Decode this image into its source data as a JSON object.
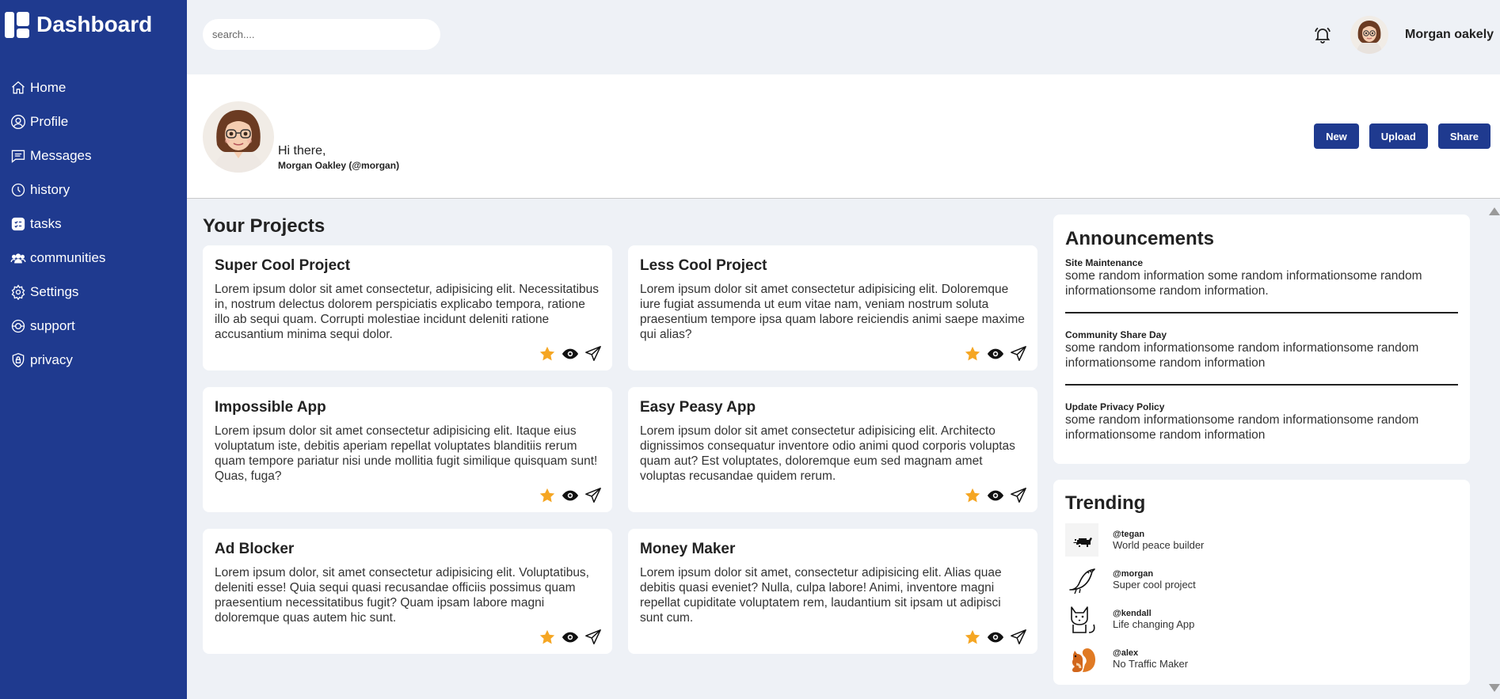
{
  "sidebar": {
    "brand": "Dashboard",
    "items": [
      {
        "label": "Home",
        "icon": "home-icon"
      },
      {
        "label": "Profile",
        "icon": "user-circle-icon"
      },
      {
        "label": "Messages",
        "icon": "message-icon"
      },
      {
        "label": "history",
        "icon": "history-icon"
      },
      {
        "label": "tasks",
        "icon": "tasks-icon"
      },
      {
        "label": "communities",
        "icon": "users-icon"
      },
      {
        "label": "Settings",
        "icon": "gear-icon"
      },
      {
        "label": "support",
        "icon": "support-icon"
      },
      {
        "label": "privacy",
        "icon": "shield-icon"
      }
    ]
  },
  "topbar": {
    "search_placeholder": "search....",
    "user_name": "Morgan oakely"
  },
  "banner": {
    "greeting": "Hi there,",
    "handle": "Morgan Oakley (@morgan)",
    "buttons": {
      "new": "New",
      "upload": "Upload",
      "share": "Share"
    }
  },
  "projects": {
    "title": "Your Projects",
    "items": [
      {
        "name": "Super Cool Project",
        "text": "Lorem ipsum dolor sit amet consectetur, adipisicing elit. Necessitatibus in, nostrum delectus dolorem perspiciatis explicabo tempora, ratione illo ab sequi quam. Corrupti molestiae incidunt deleniti ratione accusantium minima sequi dolor."
      },
      {
        "name": "Less Cool Project",
        "text": "Lorem ipsum dolor sit amet consectetur adipisicing elit. Doloremque iure fugiat assumenda ut eum vitae nam, veniam nostrum soluta praesentium tempore ipsa quam labore reiciendis animi saepe maxime qui alias?"
      },
      {
        "name": "Impossible App",
        "text": "Lorem ipsum dolor sit amet consectetur adipisicing elit. Itaque eius voluptatum iste, debitis aperiam repellat voluptates blanditiis rerum quam tempore pariatur nisi unde mollitia fugit similique quisquam sunt! Quas, fuga?"
      },
      {
        "name": "Easy Peasy App",
        "text": "Lorem ipsum dolor sit amet consectetur adipisicing elit. Architecto dignissimos consequatur inventore odio animi quod corporis voluptas quam aut? Est voluptates, doloremque eum sed magnam amet voluptas recusandae quidem rerum."
      },
      {
        "name": "Ad Blocker",
        "text": "Lorem ipsum dolor, sit amet consectetur adipisicing elit. Voluptatibus, deleniti esse! Quia sequi quasi recusandae officiis possimus quam praesentium necessitatibus fugit? Quam ipsam labore magni doloremque quas autem hic sunt."
      },
      {
        "name": "Money Maker",
        "text": "Lorem ipsum dolor sit amet, consectetur adipisicing elit. Alias quae debitis quasi eveniet? Nulla, culpa labore! Animi, inventore magni repellat cupiditate voluptatem rem, laudantium sit ipsam ut adipisci sunt cum."
      }
    ],
    "card_icons": [
      "star-icon",
      "eye-icon",
      "send-icon"
    ],
    "star_color": "#f5a623"
  },
  "announcements": {
    "title": "Announcements",
    "items": [
      {
        "title": "Site Maintenance",
        "text": "some random information some random informationsome random informationsome random information."
      },
      {
        "title": "Community Share Day",
        "text": "some random informationsome random informationsome random informationsome random information"
      },
      {
        "title": "Update Privacy Policy",
        "text": "some random informationsome random informationsome random informationsome random information"
      }
    ]
  },
  "trending": {
    "title": "Trending",
    "items": [
      {
        "handle": "@tegan",
        "desc": "World peace builder",
        "icon": "cat-pixel-icon"
      },
      {
        "handle": "@morgan",
        "desc": "Super cool project",
        "icon": "bird-icon"
      },
      {
        "handle": "@kendall",
        "desc": "Life changing App",
        "icon": "cat-icon"
      },
      {
        "handle": "@alex",
        "desc": "No Traffic Maker",
        "icon": "squirrel-icon"
      }
    ]
  },
  "colors": {
    "sidebar": "#1f3a8f",
    "button": "#1f3a8f",
    "background": "#eef1f6"
  }
}
